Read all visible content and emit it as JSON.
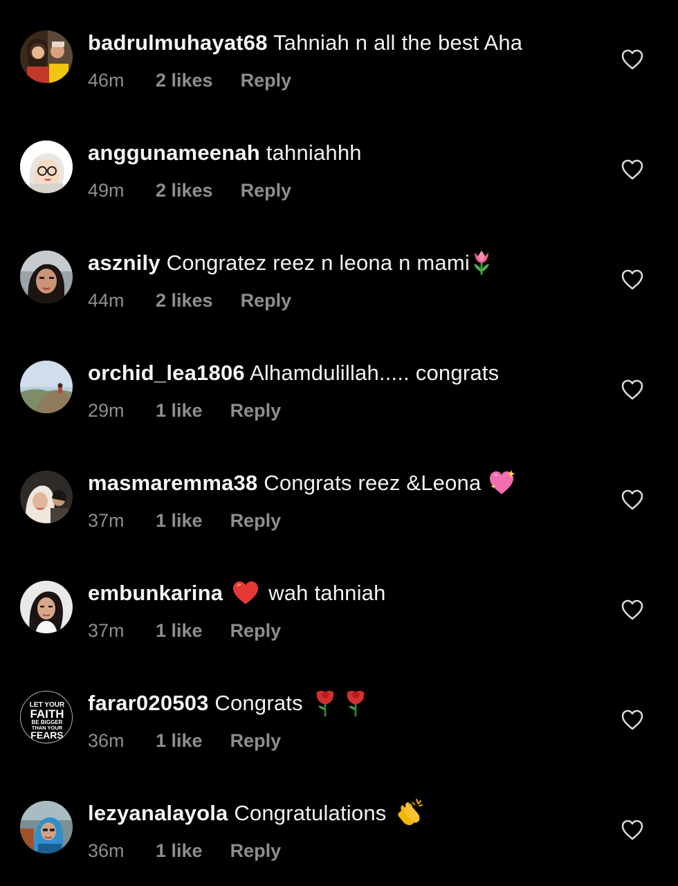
{
  "colors": {
    "background": "#000000",
    "username": "#f5f5f5",
    "text": "#f2f2f2",
    "meta": "#8e8e8e",
    "heart_outline": "#d8d8d8"
  },
  "comments": [
    {
      "username": "badrulmuhayat68",
      "text": "Tahniah n all the best Aha",
      "emojis": [],
      "time": "46m",
      "likes": "2 likes",
      "reply": "Reply",
      "avatar": "avatar-couple-photo"
    },
    {
      "username": "anggunameenah",
      "text": "tahniahhh",
      "emojis": [],
      "time": "49m",
      "likes": "2 likes",
      "reply": "Reply",
      "avatar": "avatar-cartoon-hijab"
    },
    {
      "username": "asznily",
      "text": "Congratez reez n leona n mami",
      "emojis": [
        "tulip-emoji"
      ],
      "time": "44m",
      "likes": "2 likes",
      "reply": "Reply",
      "avatar": "avatar-woman-selfie"
    },
    {
      "username": "orchid_lea1806",
      "text": "Alhamdulillah..... congrats",
      "emojis": [],
      "time": "29m",
      "likes": "1 like",
      "reply": "Reply",
      "avatar": "avatar-mountain-landscape"
    },
    {
      "username": "masmaremma38",
      "text": "Congrats reez &Leona",
      "emojis": [
        "sparkling-heart-emoji"
      ],
      "time": "37m",
      "likes": "1 like",
      "reply": "Reply",
      "avatar": "avatar-women-hijab"
    },
    {
      "username": "embunkarina",
      "text": "wah tahniah",
      "emojis": [
        "red-heart-emoji"
      ],
      "time": "37m",
      "likes": "1 like",
      "reply": "Reply",
      "avatar": "avatar-woman-portrait"
    },
    {
      "username": "farar020503",
      "text": "Congrats",
      "emojis": [
        "rose-emoji",
        "rose-emoji"
      ],
      "time": "36m",
      "likes": "1 like",
      "reply": "Reply",
      "avatar": "avatar-faith-text",
      "avatar_text": [
        "LET YOUR",
        "FAITH",
        "BE BIGGER",
        "THAN YOUR",
        "FEARS"
      ]
    },
    {
      "username": "lezyanalayola",
      "text": "Congratulations",
      "emojis": [
        "clapping-hands-emoji"
      ],
      "time": "36m",
      "likes": "1 like",
      "reply": "Reply",
      "avatar": "avatar-woman-outdoor"
    }
  ]
}
